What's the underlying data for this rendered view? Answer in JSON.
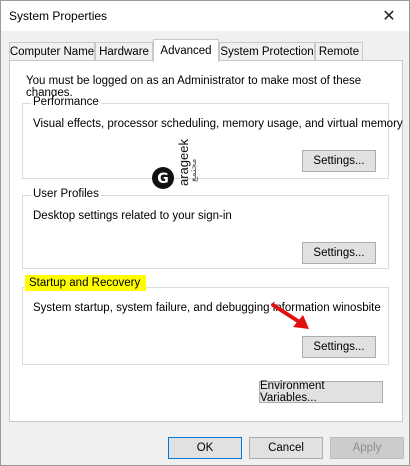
{
  "window": {
    "title": "System Properties",
    "close_glyph": "✕"
  },
  "tabs": [
    {
      "label": "Computer Name",
      "active": false
    },
    {
      "label": "Hardware",
      "active": false
    },
    {
      "label": "Advanced",
      "active": true
    },
    {
      "label": "System Protection",
      "active": false
    },
    {
      "label": "Remote",
      "active": false
    }
  ],
  "admin_note": "You must be logged on as an Administrator to make most of these changes.",
  "performance": {
    "label": "Performance",
    "description": "Visual effects, processor scheduling, memory usage, and virtual memory",
    "button": "Settings..."
  },
  "user_profiles": {
    "label": "User Profiles",
    "description": "Desktop settings related to your sign-in",
    "button": "Settings..."
  },
  "startup_recovery": {
    "label": "Startup and Recovery",
    "description": "System startup, system failure, and debugging information winosbite",
    "button": "Settings...",
    "highlight_color": "#ffff00"
  },
  "env_button": "Environment Variables...",
  "footer": {
    "ok": "OK",
    "cancel": "Cancel",
    "apply": "Apply"
  },
  "watermark": {
    "brand": "arageek",
    "sub": "مجتمع"
  },
  "colors": {
    "arrow": "#e01010",
    "focus_border": "#0078d7"
  }
}
